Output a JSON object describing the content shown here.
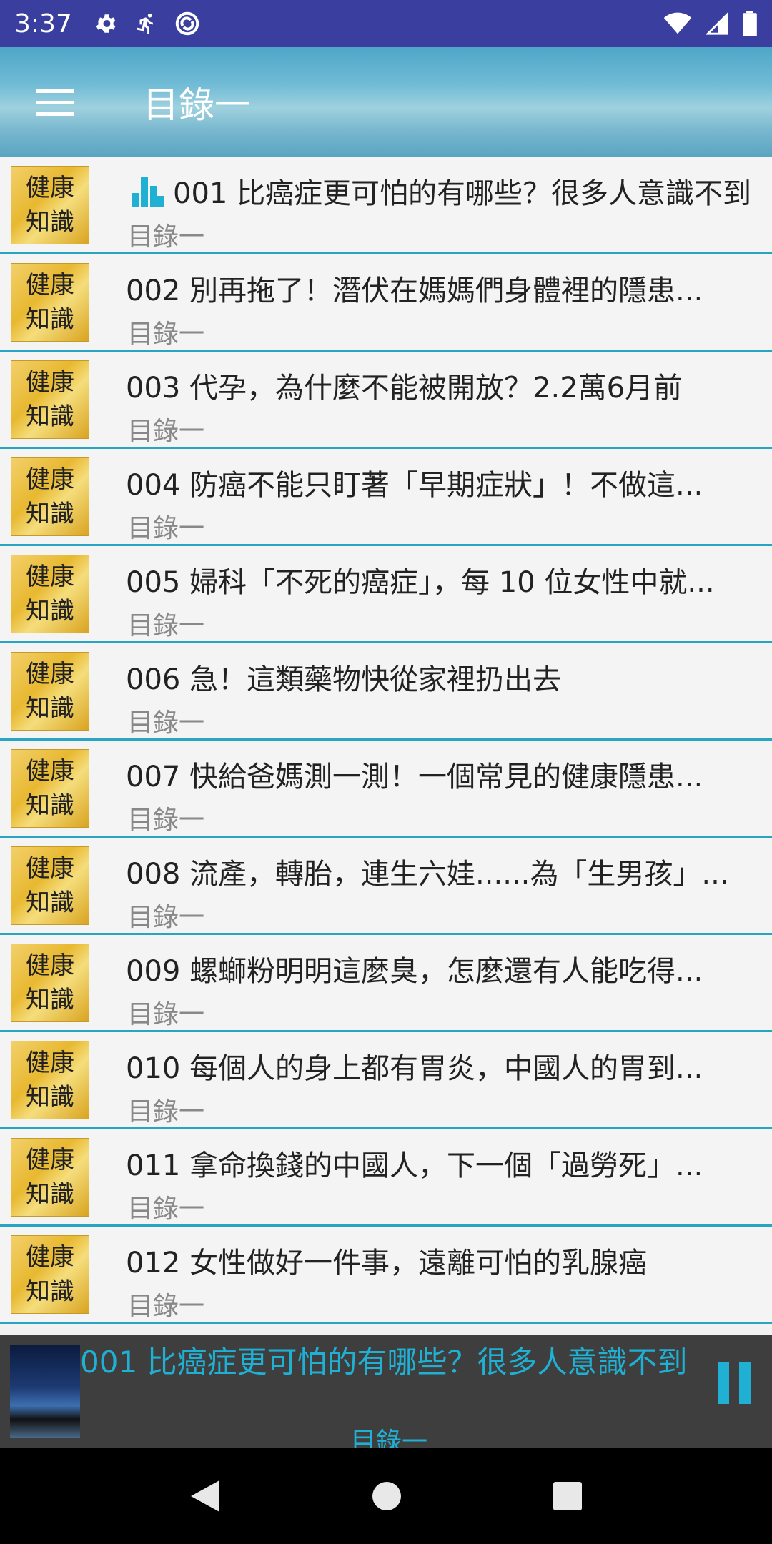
{
  "status_bar": {
    "time": "3:37"
  },
  "app_bar": {
    "title": "目錄一"
  },
  "thumb_text": {
    "line1": "健康",
    "line2": "知識"
  },
  "list": [
    {
      "title": "001 比癌症更可怕的有哪些？很多人意識不到",
      "subtitle": "目錄一",
      "playing": true
    },
    {
      "title": "002 別再拖了！潛伏在媽媽們身體裡的隱患...",
      "subtitle": "目錄一"
    },
    {
      "title": "003 代孕，為什麼不能被開放？2.2萬6月前",
      "subtitle": "目錄一"
    },
    {
      "title": "004 防癌不能只盯著「早期症狀」！不做這...",
      "subtitle": "目錄一"
    },
    {
      "title": "005 婦科「不死的癌症」，每 10 位女性中就...",
      "subtitle": "目錄一"
    },
    {
      "title": "006 急！這類藥物快從家裡扔出去",
      "subtitle": "目錄一"
    },
    {
      "title": "007 快給爸媽測一測！一個常見的健康隱患...",
      "subtitle": "目錄一"
    },
    {
      "title": "008 流產，轉胎，連生六娃......為「生男孩」...",
      "subtitle": "目錄一"
    },
    {
      "title": "009 螺螄粉明明這麼臭，怎麼還有人能吃得...",
      "subtitle": "目錄一"
    },
    {
      "title": "010 每個人的身上都有胃炎，中國人的胃到...",
      "subtitle": "目錄一"
    },
    {
      "title": "011 拿命換錢的中國人，下一個「過勞死」...",
      "subtitle": "目錄一"
    },
    {
      "title": "012 女性做好一件事，遠離可怕的乳腺癌",
      "subtitle": "目錄一"
    }
  ],
  "player": {
    "title": "001 比癌症更可怕的有哪些？很多人意識不到",
    "subtitle": "目錄一"
  },
  "colors": {
    "accent": "#1fb0d4",
    "status_bar": "#3a3f9f",
    "divider": "#27a5c2"
  }
}
